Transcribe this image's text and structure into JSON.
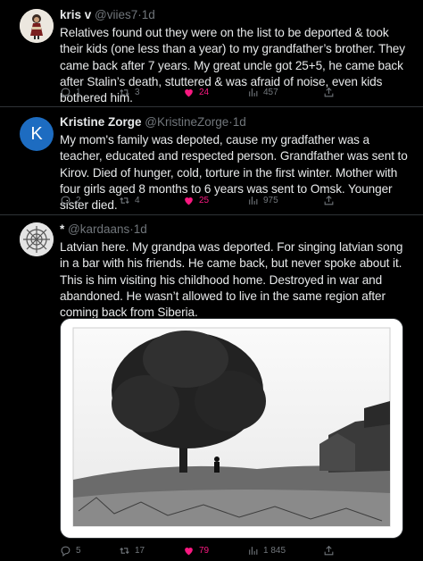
{
  "tweets": [
    {
      "name": "kris v",
      "handle": "@viies7",
      "time": "1d",
      "text": "Relatives found out they were on the list to be deported & took their kids (one less than a year) to my grandfather’s brother. They came back after 7 years. My great uncle got 25+5, he came back after Stalin’s death, stuttered & was afraid of noise, even kids bothered him.",
      "replies": "1",
      "retweets": "3",
      "likes": "24",
      "views": "457"
    },
    {
      "name": "Kristine Zorge",
      "handle": "@KristineZorge",
      "time": "1d",
      "avatar_letter": "K",
      "avatar_color": "#1d6cc1",
      "text": "My mom's family was depoted, cause my gradfather was a teacher, educated and respected person. Grandfather was sent to Kirov. Died of hunger, cold, torture in the first winter. Mother with four girls aged 8 months to 6 years was sent to Omsk. Younger sister died.",
      "replies": "2",
      "retweets": "4",
      "likes": "25",
      "views": "975"
    },
    {
      "name": "*",
      "handle": "@kardaans",
      "time": "1d",
      "text": "Latvian here. My grandpa was deported. For singing latvian song in a bar with his friends. He came back, but never spoke about it. This is him visiting his childhood home. Destroyed in war and abandoned. He wasn’t allowed to live in the same region after coming back from Siberia.",
      "replies": "5",
      "retweets": "17",
      "likes": "79",
      "views": "1 845"
    }
  ],
  "separator": "·",
  "colors": {
    "like": "#f91880",
    "muted": "#71767b",
    "text": "#e7e9ea",
    "border": "#2f3336"
  }
}
